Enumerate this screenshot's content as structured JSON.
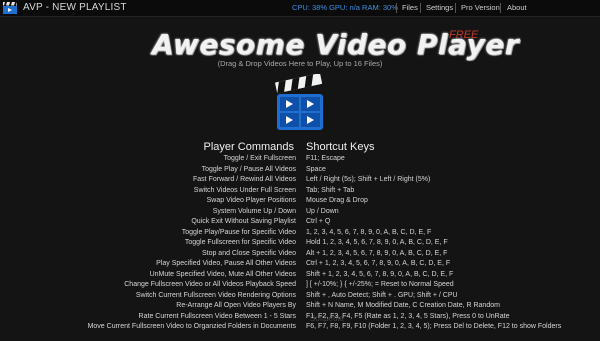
{
  "window": {
    "title": "AVP - NEW PLAYLIST",
    "stats": "CPU: 38%  GPU: n/a  RAM: 30%",
    "menu": [
      "Files",
      "Settings",
      "Pro Version",
      "About"
    ]
  },
  "brand": {
    "title": "Awesome Video Player",
    "badge": "FREE",
    "subtitle": "(Drag & Drop Videos Here to Play, Up to 16 Files)"
  },
  "table": {
    "col_commands": "Player Commands",
    "col_keys": "Shortcut Keys",
    "rows": [
      {
        "command": "Toggle / Exit Fullscreen",
        "keys": "F11;  Escape"
      },
      {
        "command": "Toggle Play / Pause All Videos",
        "keys": "Space"
      },
      {
        "command": "Fast Forward / Rewind All Videos",
        "keys": "Left / Right (5s);  Shift + Left / Right (5%)"
      },
      {
        "command": "Switch Videos Under Full Screen",
        "keys": "Tab;  Shift + Tab"
      },
      {
        "command": "Swap Video Player Positions",
        "keys": "Mouse Drag & Drop"
      },
      {
        "command": "System Volume Up / Down",
        "keys": "Up / Down"
      },
      {
        "command": "Quick Exit Without Saving Playlist",
        "keys": "Ctrl + Q"
      },
      {
        "command": "Toggle Play/Pause for Specific Video",
        "keys": "1, 2, 3, 4, 5, 6, 7, 8, 9, 0, A, B, C, D, E, F"
      },
      {
        "command": "Toggle Fullscreen for Specific Video",
        "keys": "Hold 1, 2, 3, 4, 5, 6, 7, 8, 9, 0, A, B, C, D, E, F"
      },
      {
        "command": "Stop and Close Specific Video",
        "keys": "Alt + 1, 2, 3, 4, 5, 6, 7, 8, 9, 0, A, B, C, D, E, F"
      },
      {
        "command": "Play Specified Video, Pause All Other Videos",
        "keys": "Ctrl + 1, 2, 3, 4, 5, 6, 7, 8, 9, 0, A, B, C, D, E, F"
      },
      {
        "command": "UnMute Specified Video, Mute All Other Videos",
        "keys": "Shift + 1, 2, 3, 4, 5, 6, 7, 8, 9, 0, A, B, C, D, E, F"
      },
      {
        "command": "Change Fullscreen Video or All Videos Playback Speed",
        "keys": "]  [  +/-10%;  }  {  +/-25%;  =  Reset to Normal Speed"
      },
      {
        "command": "Switch Current Fullscreen Video Rendering Options",
        "keys": "Shift + , Auto Detect;  Shift + . GPU;  Shift + /  CPU"
      },
      {
        "command": "Re-Arrange All Open Video Players By",
        "keys": "Shift + N  Name,  M  Modified Date,  C  Creation Date,  R  Random"
      },
      {
        "command": "Rate Current Fullscreen Video Between 1 - 5 Stars",
        "keys": "F1, F2, F3, F4, F5 (Rate as 1, 2, 3, 4, 5 Stars), Press 0 to UnRate"
      },
      {
        "command": "Move Current Fullscreen Video to Organzied Folders in Documents",
        "keys": "F6, F7, F8, F9, F10 (Folder 1, 2, 3, 4, 5);  Press Del to Delete, F12 to show Folders"
      }
    ]
  },
  "watermark": "Softpedia",
  "colors": {
    "stats": "#3f8fe0",
    "accent_red": "#c0392b",
    "background": "#141414",
    "icon_blue": "#1e6fd0"
  },
  "icons": {
    "app": "clapperboard-icon",
    "logo": "clapperboard-play-icon"
  }
}
